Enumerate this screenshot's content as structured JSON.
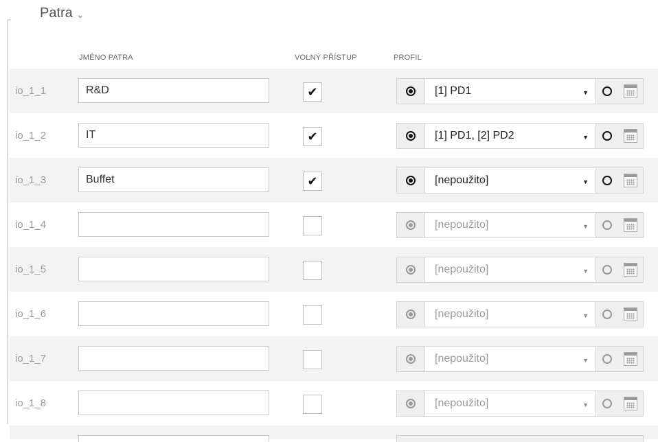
{
  "section": {
    "title": "Patra",
    "chevron_icon": "chevron-down-icon"
  },
  "columns": {
    "name": "JMÉNO PATRA",
    "free_access": "VOLNÝ PŘÍSTUP",
    "profile": "PROFIL"
  },
  "checkmark_glyph": "✔",
  "rows": [
    {
      "id": "io_1_1",
      "name": "R&D",
      "free_access": true,
      "profile": "[1] PD1",
      "enabled": true
    },
    {
      "id": "io_1_2",
      "name": "IT",
      "free_access": true,
      "profile": "[1] PD1, [2] PD2",
      "enabled": true
    },
    {
      "id": "io_1_3",
      "name": "Buffet",
      "free_access": true,
      "profile": "[nepoužito]",
      "enabled": true
    },
    {
      "id": "io_1_4",
      "name": "",
      "free_access": false,
      "profile": "[nepoužito]",
      "enabled": false
    },
    {
      "id": "io_1_5",
      "name": "",
      "free_access": false,
      "profile": "[nepoužito]",
      "enabled": false
    },
    {
      "id": "io_1_6",
      "name": "",
      "free_access": false,
      "profile": "[nepoužito]",
      "enabled": false
    },
    {
      "id": "io_1_7",
      "name": "",
      "free_access": false,
      "profile": "[nepoužito]",
      "enabled": false
    },
    {
      "id": "io_1_8",
      "name": "",
      "free_access": false,
      "profile": "[nepoužito]",
      "enabled": false
    }
  ]
}
